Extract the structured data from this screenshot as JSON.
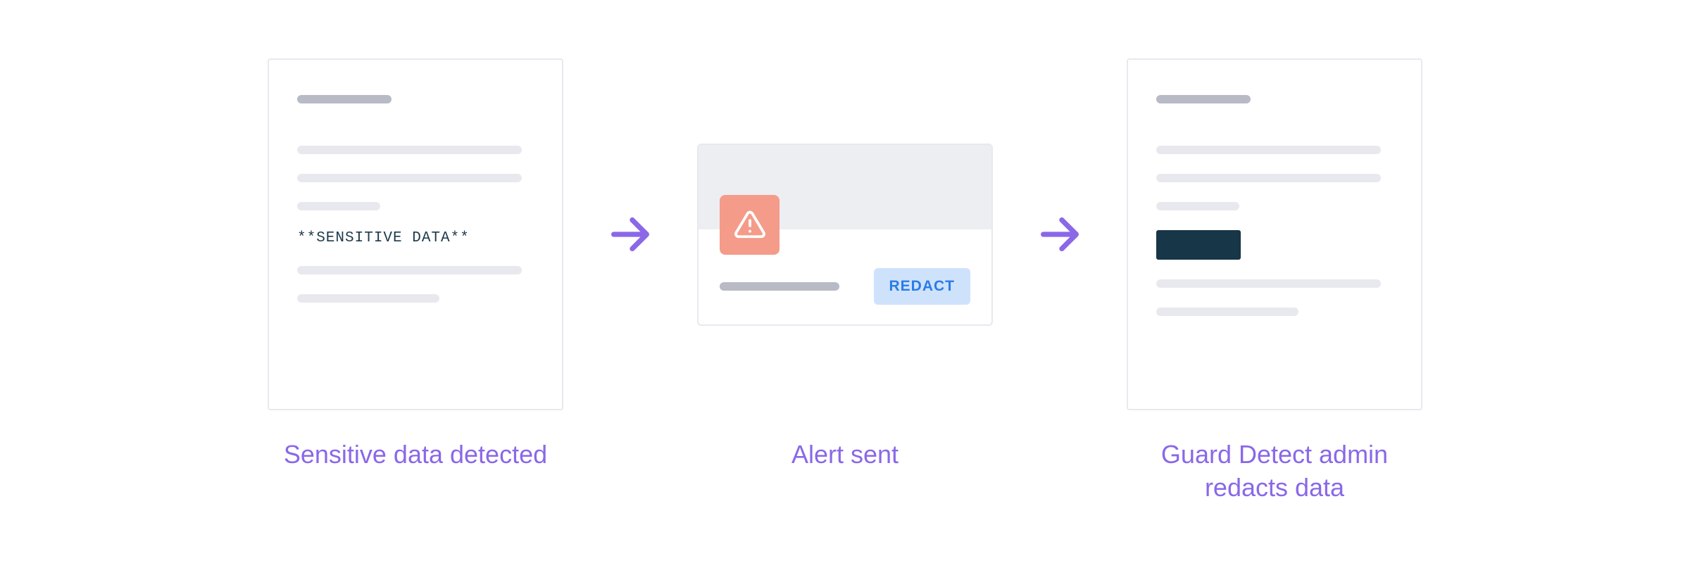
{
  "steps": {
    "detect": {
      "caption": "Sensitive data detected",
      "sensitive_label": "**SENSITIVE DATA**"
    },
    "alert": {
      "caption": "Alert sent",
      "button_label": "REDACT"
    },
    "redact": {
      "caption": "Guard Detect admin redacts data"
    }
  },
  "colors": {
    "accent": "#8a68e8",
    "alert_icon_bg": "#f59b8a",
    "redact_btn_bg": "#cfe2fb",
    "redact_btn_text": "#2a7ce8",
    "redacted_block": "#173647"
  }
}
